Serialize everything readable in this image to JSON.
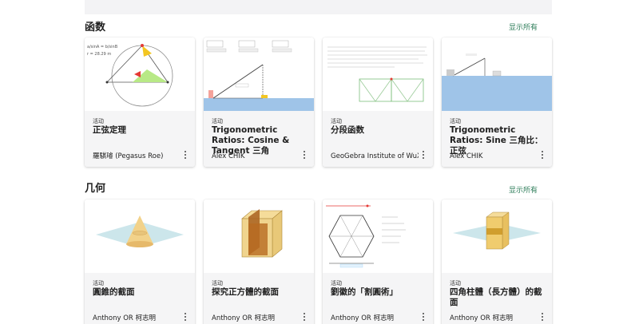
{
  "sections": [
    {
      "title": "函数",
      "show_all": "显示所有",
      "cards": [
        {
          "type": "活动",
          "title": "正弦定理",
          "author": "羅騏璿 (Pegasus Roe)"
        },
        {
          "type": "活动",
          "title": "Trigonometric Ratios: Cosine & Tangent 三角",
          "author": "Alex CHIK"
        },
        {
          "type": "活动",
          "title": "分段函数",
          "author": "GeoGebra Institute of WuXi"
        },
        {
          "type": "活动",
          "title": "Trigonometric Ratios: Sine 三角比：正弦",
          "author": "Alex CHIK"
        }
      ]
    },
    {
      "title": "几何",
      "show_all": "显示所有",
      "cards": [
        {
          "type": "活动",
          "title": "圓錐的截面",
          "author": "Anthony OR 柯志明"
        },
        {
          "type": "活动",
          "title": "探究正方體的截面",
          "author": "Anthony OR 柯志明"
        },
        {
          "type": "活动",
          "title": "劉徽的「割圓術」",
          "author": "Anthony OR 柯志明"
        },
        {
          "type": "活动",
          "title": "四角柱體（長方體）的截面",
          "author": "Anthony OR 柯志明"
        }
      ]
    }
  ],
  "icons": {
    "menu": "more-vert-icon"
  },
  "colors": {
    "accent": "#2e7d5a",
    "card_footer": "#f5f5f6",
    "topbar": "#f3f3f5"
  }
}
